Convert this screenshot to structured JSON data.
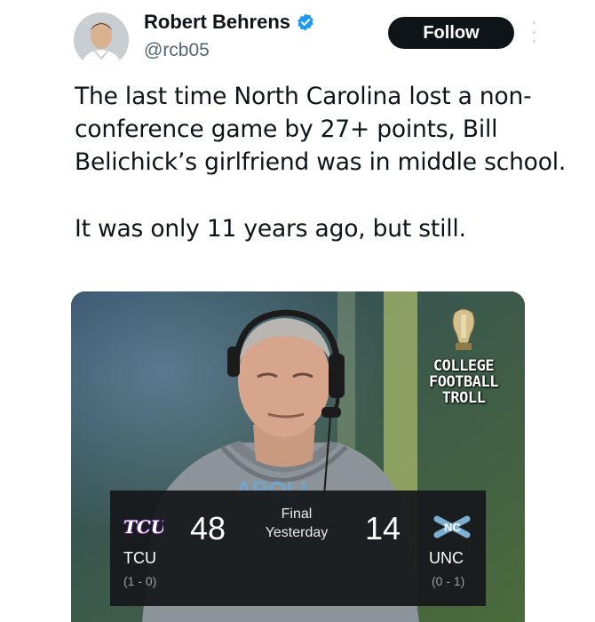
{
  "author": {
    "name": "Robert Behrens",
    "handle": "@rcb05",
    "verified": true,
    "avatar_icon": "profile-photo"
  },
  "actions": {
    "follow_label": "Follow",
    "more_icon": "vertical-ellipsis-icon"
  },
  "tweet": {
    "paragraphs": [
      "The last time North Carolina lost a non-conference game by 27+ points, Bill Belichick’s girlfriend was in middle school.",
      "It was only 11 years ago, but still."
    ]
  },
  "media": {
    "watermark": [
      "COLLEGE",
      "FOOTBALL",
      "TROLL"
    ],
    "scoreboard": {
      "status_line1": "Final",
      "status_line2": "Yesterday",
      "away": {
        "abbr": "TCU",
        "score": "48",
        "record": "(1 - 0)",
        "logo_text": "TCU"
      },
      "home": {
        "abbr": "UNC",
        "score": "14",
        "record": "(0 - 1)"
      }
    }
  },
  "colors": {
    "text_primary": "#0f1419",
    "text_secondary": "#536471",
    "verified_blue": "#1d9bf0",
    "follow_bg": "#0f1419",
    "tcu_purple": "#4d1979",
    "unc_blue": "#7bafd4"
  }
}
